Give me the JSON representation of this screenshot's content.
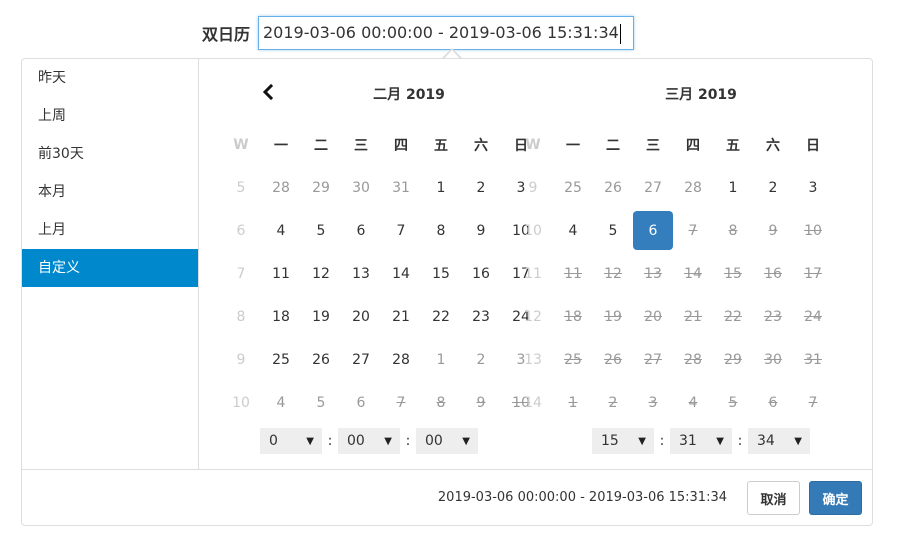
{
  "field": {
    "label": "双日历",
    "value": "2019-03-06 00:00:00 - 2019-03-06 15:31:34"
  },
  "ranges": [
    {
      "label": "昨天",
      "active": false
    },
    {
      "label": "上周",
      "active": false
    },
    {
      "label": "前30天",
      "active": false
    },
    {
      "label": "本月",
      "active": false
    },
    {
      "label": "上月",
      "active": false
    },
    {
      "label": "自定义",
      "active": true
    }
  ],
  "calendars": [
    {
      "title": "二月 2019",
      "week_header": "W",
      "weekdays": [
        "一",
        "二",
        "三",
        "四",
        "五",
        "六",
        "日"
      ],
      "rows": [
        {
          "week": "5",
          "days": [
            [
              "28",
              "off"
            ],
            [
              "29",
              "off"
            ],
            [
              "30",
              "off"
            ],
            [
              "31",
              "off"
            ],
            [
              "1",
              "cur"
            ],
            [
              "2",
              "cur"
            ],
            [
              "3",
              "cur"
            ]
          ]
        },
        {
          "week": "6",
          "days": [
            [
              "4",
              "cur"
            ],
            [
              "5",
              "cur"
            ],
            [
              "6",
              "cur"
            ],
            [
              "7",
              "cur"
            ],
            [
              "8",
              "cur"
            ],
            [
              "9",
              "cur"
            ],
            [
              "10",
              "cur"
            ]
          ]
        },
        {
          "week": "7",
          "days": [
            [
              "11",
              "cur"
            ],
            [
              "12",
              "cur"
            ],
            [
              "13",
              "cur"
            ],
            [
              "14",
              "cur"
            ],
            [
              "15",
              "cur"
            ],
            [
              "16",
              "cur"
            ],
            [
              "17",
              "cur"
            ]
          ]
        },
        {
          "week": "8",
          "days": [
            [
              "18",
              "cur"
            ],
            [
              "19",
              "cur"
            ],
            [
              "20",
              "cur"
            ],
            [
              "21",
              "cur"
            ],
            [
              "22",
              "cur"
            ],
            [
              "23",
              "cur"
            ],
            [
              "24",
              "cur"
            ]
          ]
        },
        {
          "week": "9",
          "days": [
            [
              "25",
              "cur"
            ],
            [
              "26",
              "cur"
            ],
            [
              "27",
              "cur"
            ],
            [
              "28",
              "cur"
            ],
            [
              "1",
              "off"
            ],
            [
              "2",
              "off"
            ],
            [
              "3",
              "off"
            ]
          ]
        },
        {
          "week": "10",
          "days": [
            [
              "4",
              "off"
            ],
            [
              "5",
              "off"
            ],
            [
              "6",
              "off"
            ],
            [
              "7",
              "dis"
            ],
            [
              "8",
              "dis"
            ],
            [
              "9",
              "dis"
            ],
            [
              "10",
              "dis"
            ]
          ]
        }
      ],
      "time": {
        "hour": "0",
        "minute": "00",
        "second": "00"
      }
    },
    {
      "title": "三月 2019",
      "week_header": "W",
      "weekdays": [
        "一",
        "二",
        "三",
        "四",
        "五",
        "六",
        "日"
      ],
      "rows": [
        {
          "week": "9",
          "days": [
            [
              "25",
              "off"
            ],
            [
              "26",
              "off"
            ],
            [
              "27",
              "off"
            ],
            [
              "28",
              "off"
            ],
            [
              "1",
              "cur"
            ],
            [
              "2",
              "cur"
            ],
            [
              "3",
              "cur"
            ]
          ]
        },
        {
          "week": "10",
          "days": [
            [
              "4",
              "cur"
            ],
            [
              "5",
              "cur"
            ],
            [
              "6",
              "sel"
            ],
            [
              "7",
              "dis"
            ],
            [
              "8",
              "dis"
            ],
            [
              "9",
              "dis"
            ],
            [
              "10",
              "dis"
            ]
          ]
        },
        {
          "week": "11",
          "days": [
            [
              "11",
              "dis"
            ],
            [
              "12",
              "dis"
            ],
            [
              "13",
              "dis"
            ],
            [
              "14",
              "dis"
            ],
            [
              "15",
              "dis"
            ],
            [
              "16",
              "dis"
            ],
            [
              "17",
              "dis"
            ]
          ]
        },
        {
          "week": "12",
          "days": [
            [
              "18",
              "dis"
            ],
            [
              "19",
              "dis"
            ],
            [
              "20",
              "dis"
            ],
            [
              "21",
              "dis"
            ],
            [
              "22",
              "dis"
            ],
            [
              "23",
              "dis"
            ],
            [
              "24",
              "dis"
            ]
          ]
        },
        {
          "week": "13",
          "days": [
            [
              "25",
              "dis"
            ],
            [
              "26",
              "dis"
            ],
            [
              "27",
              "dis"
            ],
            [
              "28",
              "dis"
            ],
            [
              "29",
              "dis"
            ],
            [
              "30",
              "dis"
            ],
            [
              "31",
              "dis"
            ]
          ]
        },
        {
          "week": "14",
          "days": [
            [
              "1",
              "dis"
            ],
            [
              "2",
              "dis"
            ],
            [
              "3",
              "dis"
            ],
            [
              "4",
              "dis"
            ],
            [
              "5",
              "dis"
            ],
            [
              "6",
              "dis"
            ],
            [
              "7",
              "dis"
            ]
          ]
        }
      ],
      "time": {
        "hour": "15",
        "minute": "31",
        "second": "34"
      }
    }
  ],
  "footer": {
    "range_text": "2019-03-06 00:00:00 - 2019-03-06 15:31:34",
    "cancel_label": "取消",
    "ok_label": "确定"
  },
  "icons": {
    "prev": "chevron-left-icon",
    "select_arrow": "▼"
  },
  "colors": {
    "active_range": "#0088cc",
    "selected_day": "#357ebd",
    "ok_button": "#337ab7",
    "input_focus": "#66afe9"
  }
}
